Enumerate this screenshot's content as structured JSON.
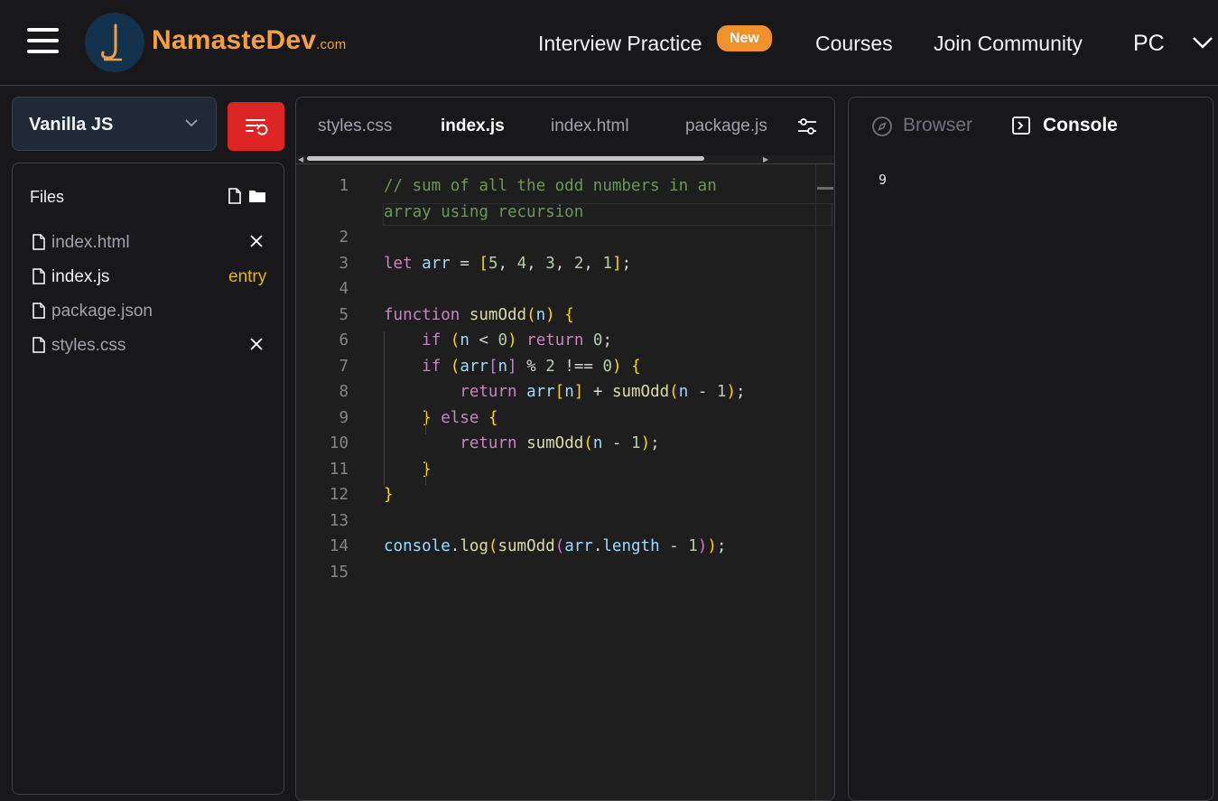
{
  "header": {
    "brand_name": "NamasteDev",
    "brand_suffix": ".com",
    "nav": [
      {
        "label": "Interview Practice",
        "badge": "New"
      },
      {
        "label": "Courses"
      },
      {
        "label": "Join Community"
      }
    ],
    "user_initials": "PC"
  },
  "sidebar": {
    "framework": "Vanilla JS",
    "files_title": "Files",
    "files": [
      {
        "name": "index.html",
        "closable": true
      },
      {
        "name": "index.js",
        "tag": "entry",
        "active": true
      },
      {
        "name": "package.json"
      },
      {
        "name": "styles.css",
        "closable": true
      }
    ]
  },
  "editor": {
    "tabs": [
      "styles.css",
      "index.js",
      "index.html",
      "package.js"
    ],
    "active_tab": "index.js",
    "line_numbers": [
      "1",
      "2",
      "3",
      "4",
      "5",
      "6",
      "7",
      "8",
      "9",
      "10",
      "11",
      "12",
      "13",
      "14",
      "15"
    ],
    "code_lines": [
      "// sum of all the odd numbers in an array using recursion",
      "",
      "let arr = [5, 4, 3, 2, 1];",
      "",
      "function sumOdd(n) {",
      "    if (n < 0) return 0;",
      "    if (arr[n] % 2 !== 0) {",
      "        return arr[n] + sumOdd(n - 1);",
      "    } else {",
      "        return sumOdd(n - 1);",
      "    }",
      "}",
      "",
      "console.log(sumOdd(arr.length - 1));",
      ""
    ],
    "comment_wrapped": [
      "// sum of all the odd numbers in an",
      "array using recursion"
    ]
  },
  "preview": {
    "tabs": [
      "Browser",
      "Console"
    ],
    "active_tab": "Console",
    "console_output": "9"
  },
  "colors": {
    "accent": "#f59e42",
    "reset_button": "#dc2626",
    "entry_tag": "#eab308"
  }
}
